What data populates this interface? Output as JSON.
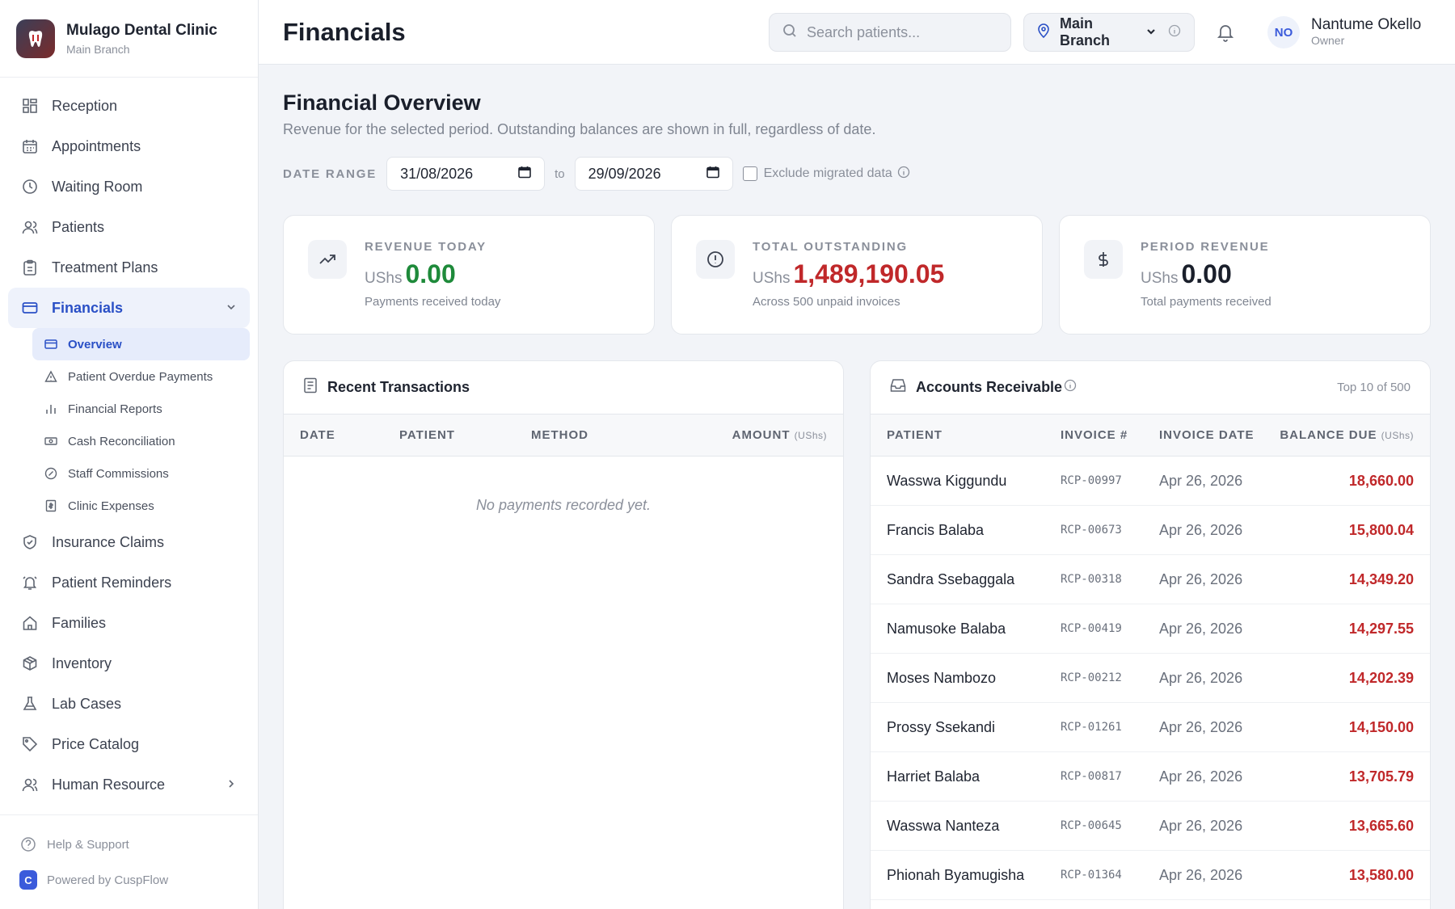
{
  "brand": {
    "name": "Mulago Dental Clinic",
    "branch": "Main Branch"
  },
  "nav": {
    "reception": "Reception",
    "appointments": "Appointments",
    "waiting_room": "Waiting Room",
    "patients": "Patients",
    "treatment_plans": "Treatment Plans",
    "financials": "Financials",
    "sub": {
      "overview": "Overview",
      "overdue": "Patient Overdue Payments",
      "reports": "Financial Reports",
      "cash": "Cash Reconciliation",
      "commissions": "Staff Commissions",
      "expenses": "Clinic Expenses"
    },
    "insurance": "Insurance Claims",
    "reminders": "Patient Reminders",
    "families": "Families",
    "inventory": "Inventory",
    "lab": "Lab Cases",
    "price": "Price Catalog",
    "hr": "Human Resource"
  },
  "footer": {
    "help": "Help & Support",
    "powered": "Powered by CuspFlow",
    "logo_letter": "C"
  },
  "header": {
    "title": "Financials",
    "search_placeholder": "Search patients...",
    "branch": "Main Branch",
    "user_initials": "NO",
    "user_name": "Nantume Okello",
    "user_role": "Owner"
  },
  "overview": {
    "title": "Financial Overview",
    "subtitle": "Revenue for the selected period. Outstanding balances are shown in full, regardless of date.",
    "date_range_label": "DATE RANGE",
    "date_from": "31/08/2026",
    "to_label": "to",
    "date_to": "29/09/2026",
    "exclude_label": "Exclude migrated data"
  },
  "cards": [
    {
      "label": "REVENUE TODAY",
      "currency": "UShs",
      "value": "0.00",
      "desc": "Payments received today",
      "color": "#1e8a3a"
    },
    {
      "label": "TOTAL OUTSTANDING",
      "currency": "UShs",
      "value": "1,489,190.05",
      "desc": "Across 500 unpaid invoices",
      "color": "#c0282a"
    },
    {
      "label": "PERIOD REVENUE",
      "currency": "UShs",
      "value": "0.00",
      "desc": "Total payments received",
      "color": "#1a1f2b"
    }
  ],
  "transactions": {
    "title": "Recent Transactions",
    "columns": {
      "date": "DATE",
      "patient": "PATIENT",
      "method": "METHOD",
      "amount": "AMOUNT",
      "amount_unit": "(UShs)"
    },
    "empty": "No payments recorded yet."
  },
  "receivables": {
    "title": "Accounts Receivable",
    "summary": "Top 10 of 500",
    "columns": {
      "patient": "PATIENT",
      "invoice": "INVOICE #",
      "date": "INVOICE DATE",
      "balance": "BALANCE DUE",
      "balance_unit": "(UShs)"
    },
    "rows": [
      {
        "patient": "Wasswa Kiggundu",
        "invoice": "RCP-00997",
        "date": "Apr 26, 2026",
        "balance": "18,660.00"
      },
      {
        "patient": "Francis Balaba",
        "invoice": "RCP-00673",
        "date": "Apr 26, 2026",
        "balance": "15,800.04"
      },
      {
        "patient": "Sandra Ssebaggala",
        "invoice": "RCP-00318",
        "date": "Apr 26, 2026",
        "balance": "14,349.20"
      },
      {
        "patient": "Namusoke Balaba",
        "invoice": "RCP-00419",
        "date": "Apr 26, 2026",
        "balance": "14,297.55"
      },
      {
        "patient": "Moses Nambozo",
        "invoice": "RCP-00212",
        "date": "Apr 26, 2026",
        "balance": "14,202.39"
      },
      {
        "patient": "Prossy Ssekandi",
        "invoice": "RCP-01261",
        "date": "Apr 26, 2026",
        "balance": "14,150.00"
      },
      {
        "patient": "Harriet Balaba",
        "invoice": "RCP-00817",
        "date": "Apr 26, 2026",
        "balance": "13,705.79"
      },
      {
        "patient": "Wasswa Nanteza",
        "invoice": "RCP-00645",
        "date": "Apr 26, 2026",
        "balance": "13,665.60"
      },
      {
        "patient": "Phionah Byamugisha",
        "invoice": "RCP-01364",
        "date": "Apr 26, 2026",
        "balance": "13,580.00"
      }
    ]
  }
}
